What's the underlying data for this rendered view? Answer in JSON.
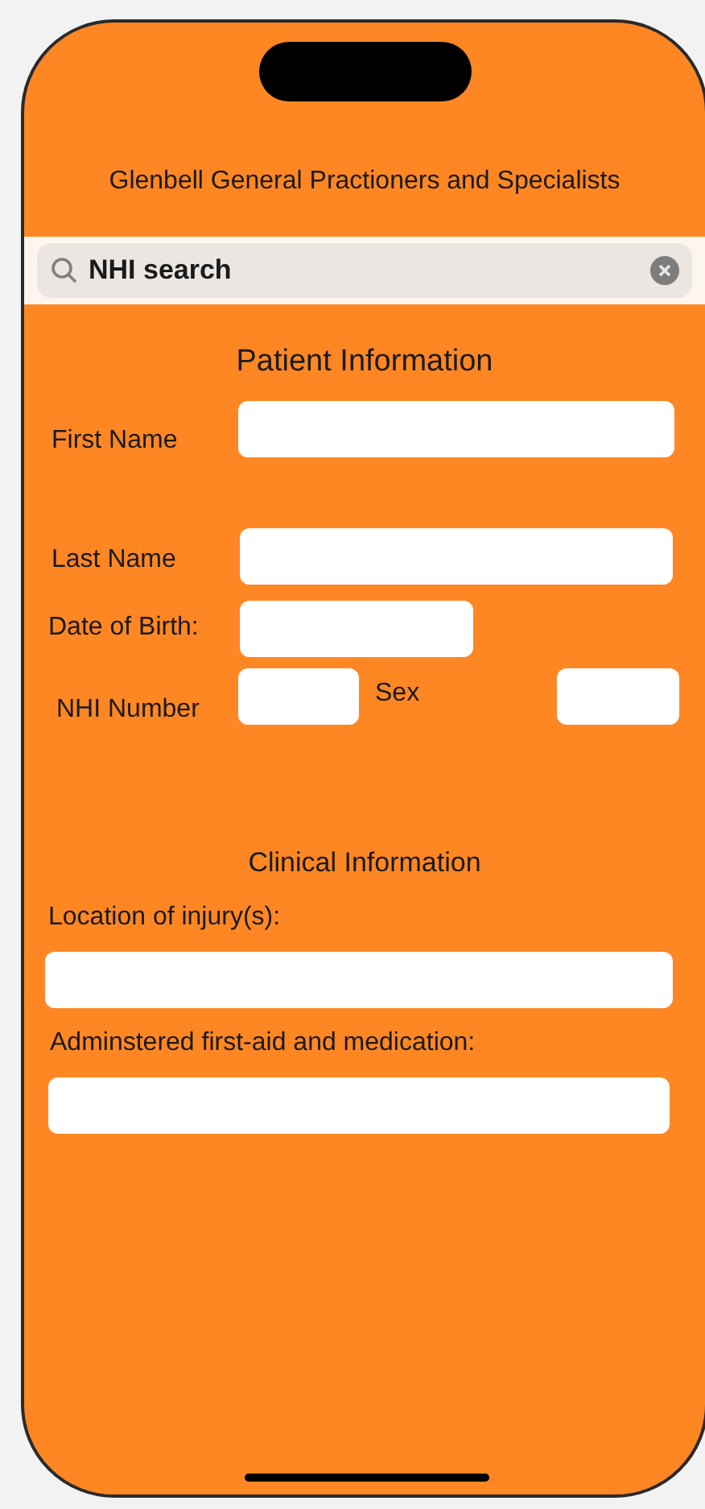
{
  "title": "Glenbell General Practioners and Specialists",
  "search": {
    "value": "NHI search"
  },
  "patient": {
    "heading": "Patient Information",
    "first_name": {
      "label": "First Name"
    },
    "last_name": {
      "label": "Last Name"
    },
    "date_of_birth": {
      "label": "Date of Birth:"
    },
    "nhi_number": {
      "label": "NHI Number"
    },
    "sex": {
      "label": "Sex"
    }
  },
  "clinical": {
    "heading": "Clinical Information",
    "injury_location": {
      "label": "Location of injury(s):"
    },
    "first_aid": {
      "label": "Adminstered first-aid and medication:"
    }
  }
}
